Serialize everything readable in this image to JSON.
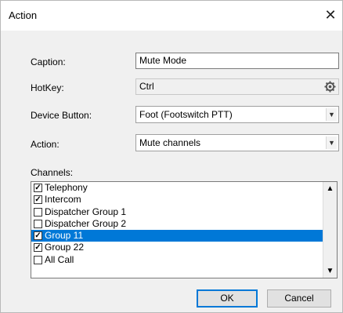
{
  "dialog": {
    "title": "Action",
    "close_glyph": "✕"
  },
  "form": {
    "caption_label": "Caption:",
    "caption_value": "Mute Mode",
    "hotkey_label": "HotKey:",
    "hotkey_value": "Ctrl",
    "hotkey_icon": "gear-icon",
    "device_button_label": "Device Button:",
    "device_button_value": "Foot (Footswitch PTT)",
    "action_label": "Action:",
    "action_value": "Mute channels"
  },
  "channels": {
    "label": "Channels:",
    "items": [
      {
        "label": "Telephony",
        "checked": true,
        "selected": false
      },
      {
        "label": "Intercom",
        "checked": true,
        "selected": false
      },
      {
        "label": "Dispatcher Group 1",
        "checked": false,
        "selected": false
      },
      {
        "label": "Dispatcher Group 2",
        "checked": false,
        "selected": false
      },
      {
        "label": "Group 11",
        "checked": true,
        "selected": true
      },
      {
        "label": "Group 22",
        "checked": true,
        "selected": false
      },
      {
        "label": "All Call",
        "checked": false,
        "selected": false
      }
    ]
  },
  "buttons": {
    "ok": "OK",
    "cancel": "Cancel"
  },
  "colors": {
    "selection": "#0078d7",
    "dialog_bg": "#f0f0f0"
  }
}
